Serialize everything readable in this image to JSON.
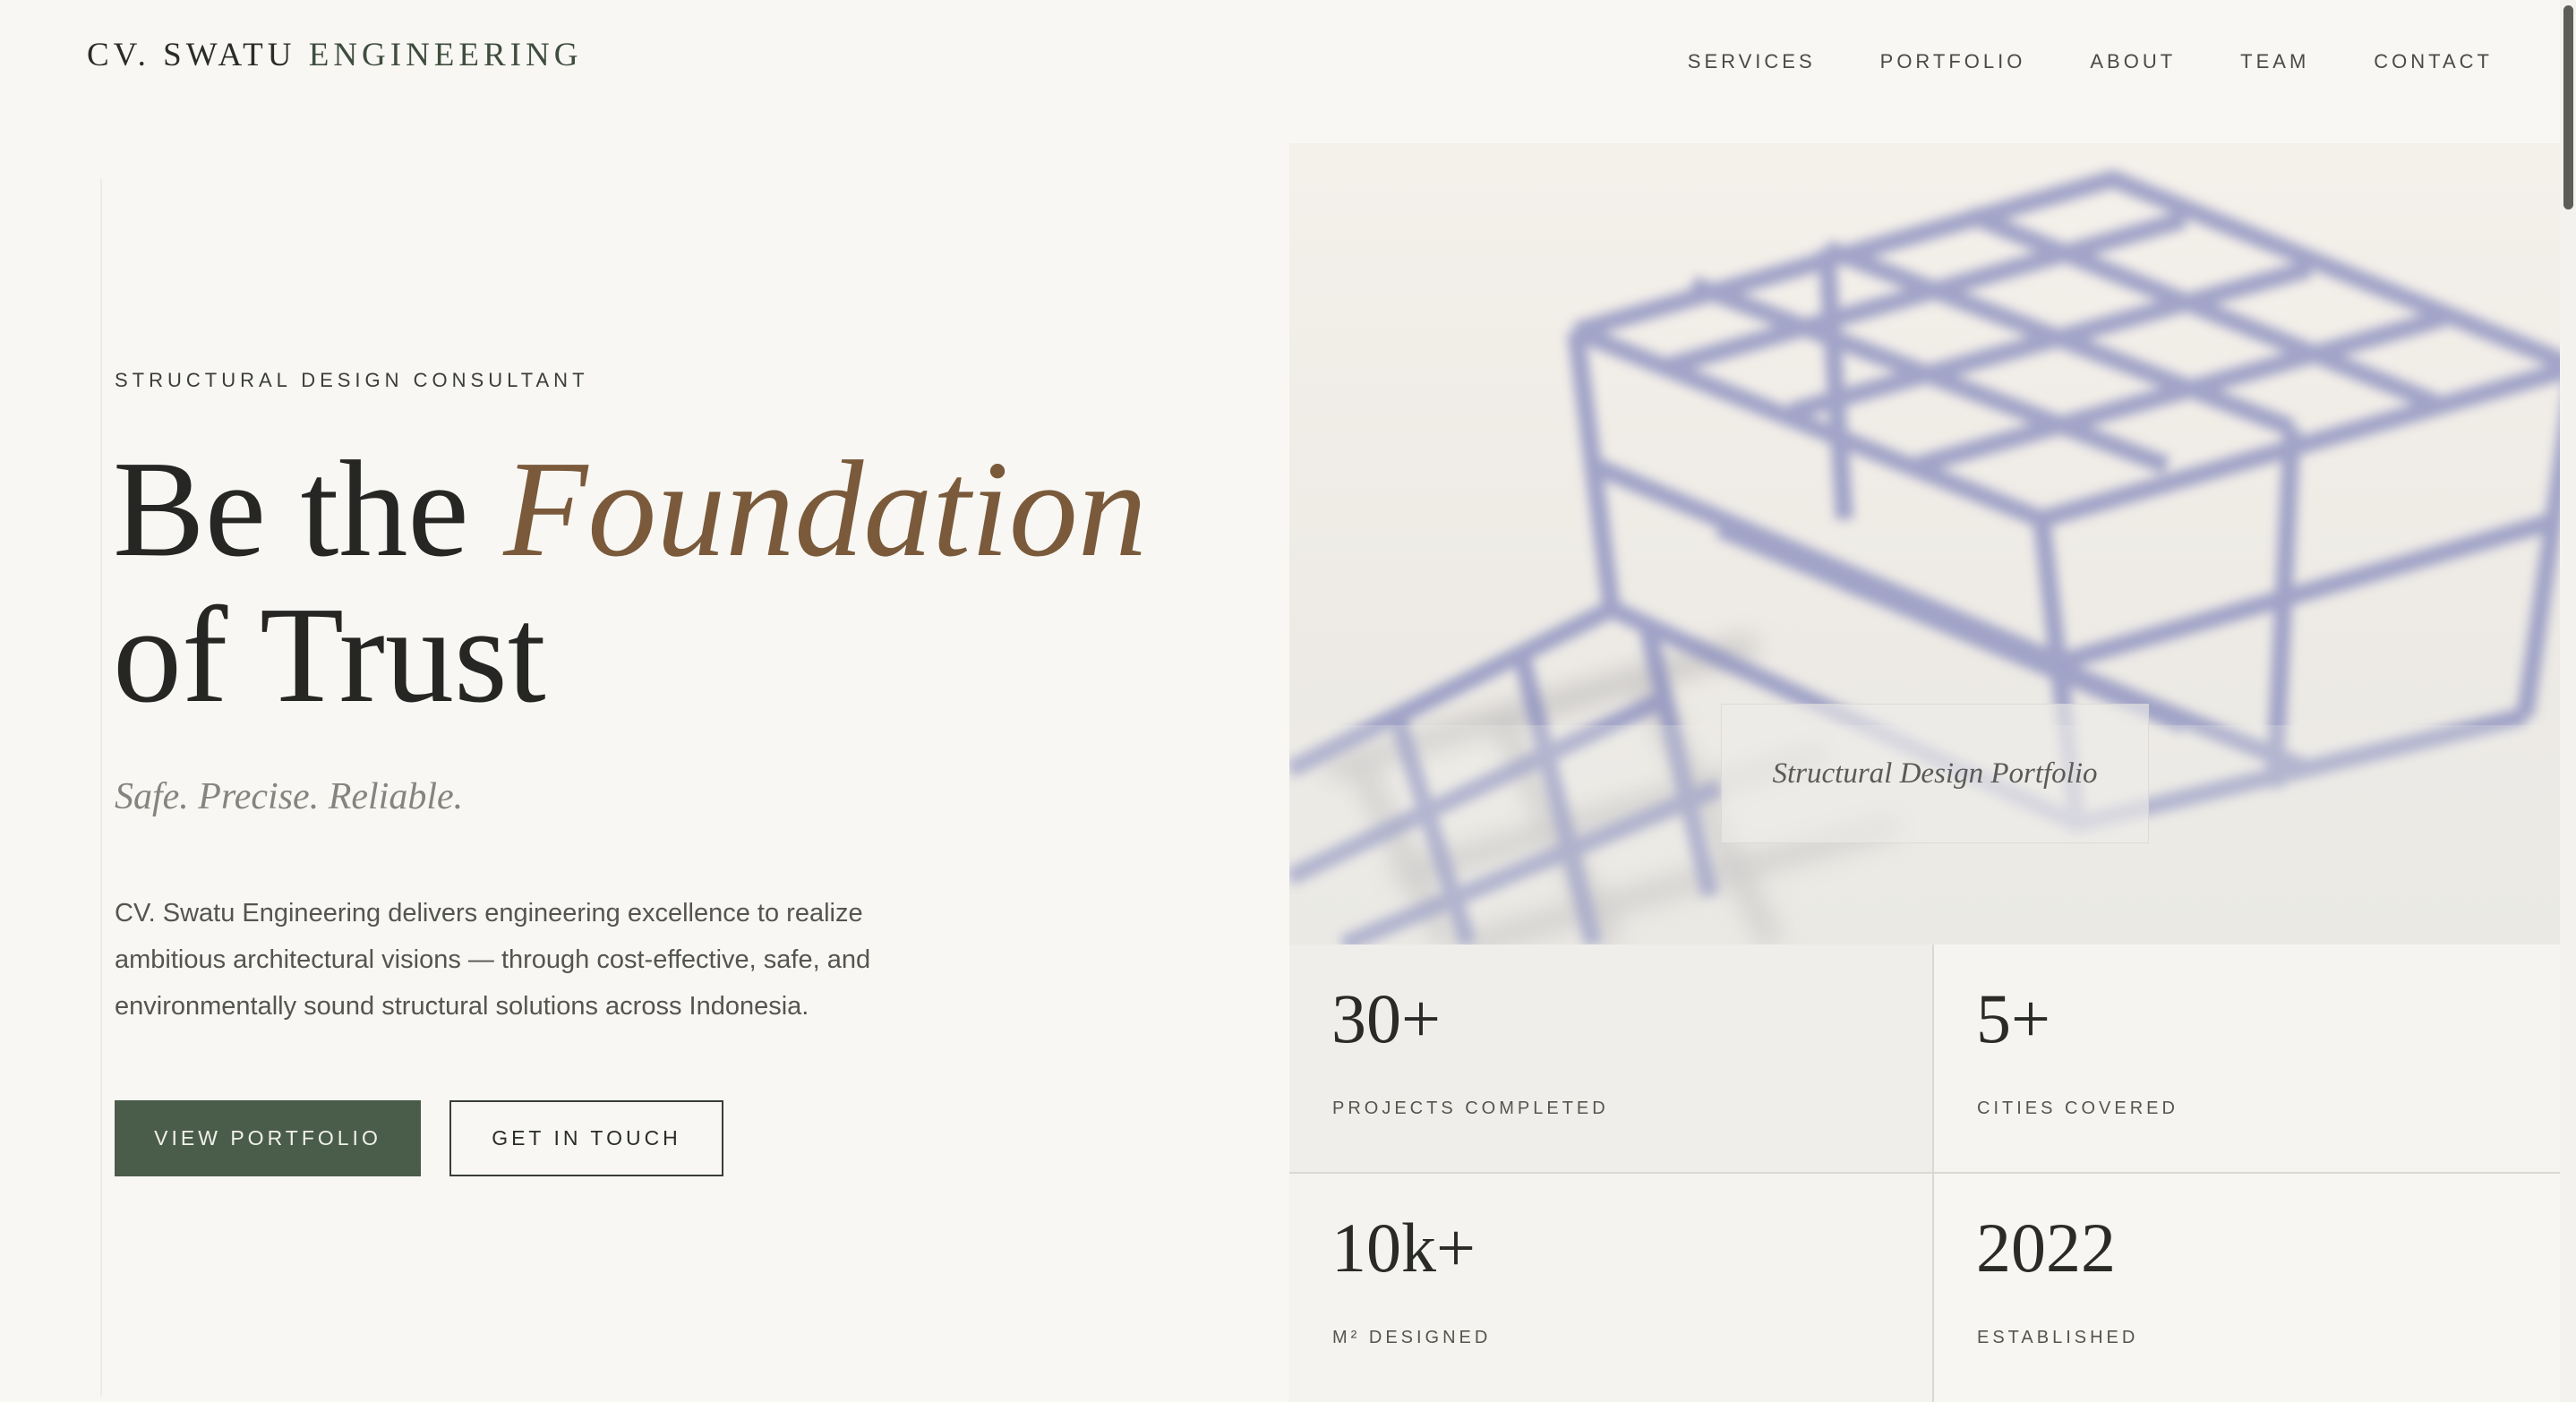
{
  "brand": {
    "part1": "CV. SWATU",
    "part2": "ENGINEERING"
  },
  "nav": {
    "items": [
      "SERVICES",
      "PORTFOLIO",
      "ABOUT",
      "TEAM",
      "CONTACT"
    ]
  },
  "hero": {
    "eyebrow": "STRUCTURAL DESIGN CONSULTANT",
    "headline_start": "Be the",
    "headline_accent": "Foundation",
    "headline_end": "of Trust",
    "tagline": "Safe. Precise. Reliable.",
    "lead": "CV. Swatu Engineering delivers engineering excellence to realize ambitious architectural visions — through cost-effective, safe, and environmentally sound structural solutions across Indonesia.",
    "primary_button": "VIEW PORTFOLIO",
    "secondary_button": "GET IN TOUCH"
  },
  "image": {
    "caption": "Structural Design Portfolio"
  },
  "stats": [
    {
      "value": "30+",
      "label": "PROJECTS COMPLETED"
    },
    {
      "value": "5+",
      "label": "CITIES COVERED"
    },
    {
      "value": "10k+",
      "label": "M² DESIGNED"
    },
    {
      "value": "2022",
      "label": "ESTABLISHED"
    }
  ],
  "colors": {
    "background": "#f8f7f4",
    "accent": "#7a5a3a",
    "primary_button": "#4a5c4a",
    "frame_model": "#8a8fc0"
  }
}
